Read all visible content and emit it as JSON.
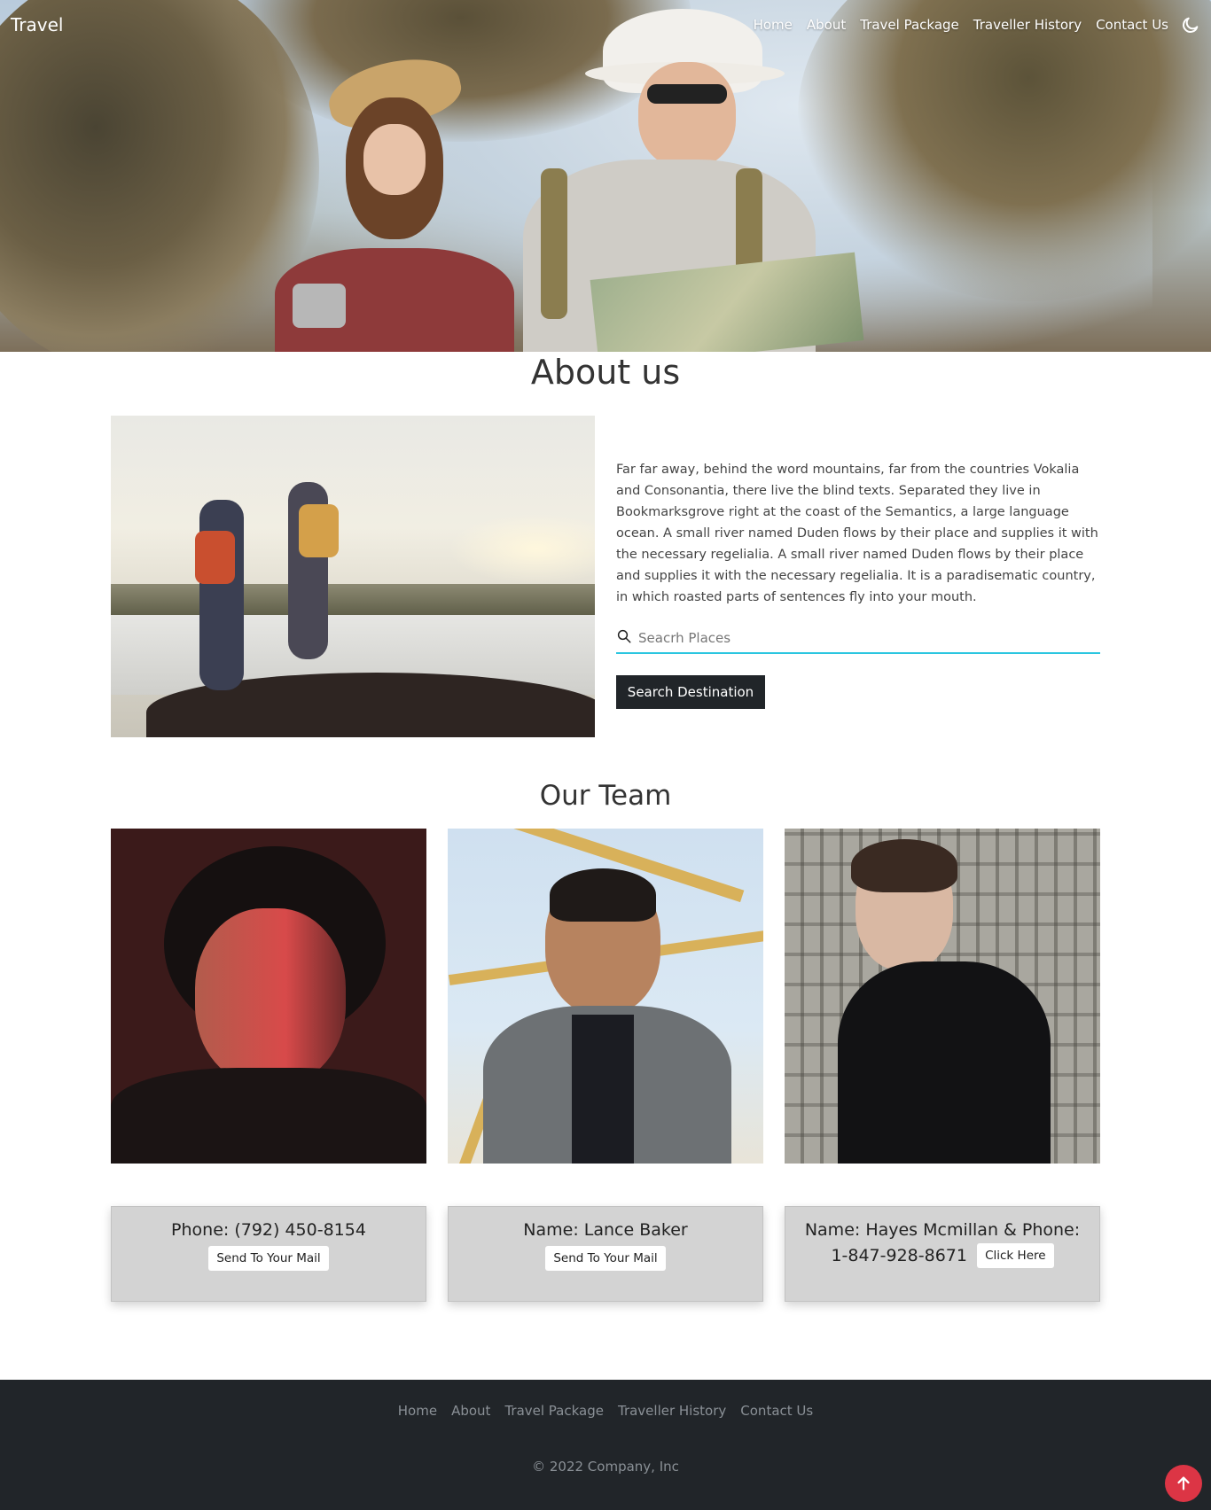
{
  "nav": {
    "brand": "Travel",
    "links": [
      "Home",
      "About",
      "Travel Package",
      "Traveller History",
      "Contact Us"
    ],
    "theme_icon": "moon-icon"
  },
  "about": {
    "title": "About us",
    "paragraph": "Far far away, behind the word mountains, far from the countries Vokalia and Consonantia, there live the blind texts. Separated they live in Bookmarksgrove right at the coast of the Semantics, a large language ocean. A small river named Duden flows by their place and supplies it with the necessary regelialia. A small river named Duden flows by their place and supplies it with the necessary regelialia. It is a paradisematic country, in which roasted parts of sentences fly into your mouth.",
    "search_placeholder": "Seacrh Places",
    "search_button": "Search Destination"
  },
  "team": {
    "title": "Our Team",
    "cards": [
      {
        "line1": "Phone: (792) 450-8154",
        "button": "Send To Your Mail"
      },
      {
        "line1": "Name: Lance Baker",
        "button": "Send To Your Mail"
      },
      {
        "line1": "Name: Hayes Mcmillan & Phone:",
        "line2": "1-847-928-8671",
        "button": "Click Here"
      }
    ]
  },
  "footer": {
    "links": [
      "Home",
      "About",
      "Travel Package",
      "Traveller History",
      "Contact Us"
    ],
    "copyright": "© 2022 Company, Inc"
  },
  "colors": {
    "accent": "#2bc6e0",
    "dark": "#212529",
    "back_to_top": "#dc3545",
    "card_bg": "#d3d3d3"
  },
  "icons": {
    "search": "search-icon",
    "back_to_top": "arrow-up-icon"
  }
}
